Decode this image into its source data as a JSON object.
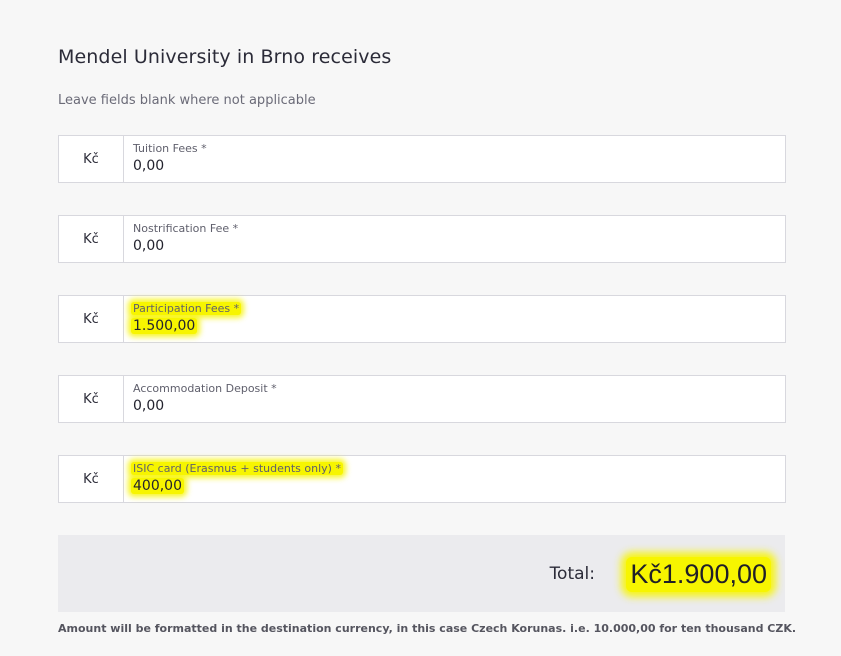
{
  "heading": "Mendel University in Brno receives",
  "subtitle": "Leave fields blank where not applicable",
  "fields": [
    {
      "prefix": "Kč",
      "label": "Tuition Fees *",
      "value": "0,00",
      "highlighted": false
    },
    {
      "prefix": "Kč",
      "label": "Nostrification Fee *",
      "value": "0,00",
      "highlighted": false
    },
    {
      "prefix": "Kč",
      "label": "Participation Fees *",
      "value": "1.500,00",
      "highlighted": true
    },
    {
      "prefix": "Kč",
      "label": "Accommodation Deposit *",
      "value": "0,00",
      "highlighted": false
    },
    {
      "prefix": "Kč",
      "label": "ISIC card (Erasmus + students only) *",
      "value": "400,00",
      "highlighted": true
    }
  ],
  "total": {
    "label": "Total:",
    "value": "Kč1.900,00"
  },
  "footnote": "Amount will be formatted in the destination currency, in this case Czech Korunas. i.e. 10.000,00 for ten thousand CZK.",
  "colors": {
    "highlight": "#f7f500",
    "background": "#f7f7f7",
    "total_box": "#ebebee",
    "border": "#d8d8de"
  }
}
